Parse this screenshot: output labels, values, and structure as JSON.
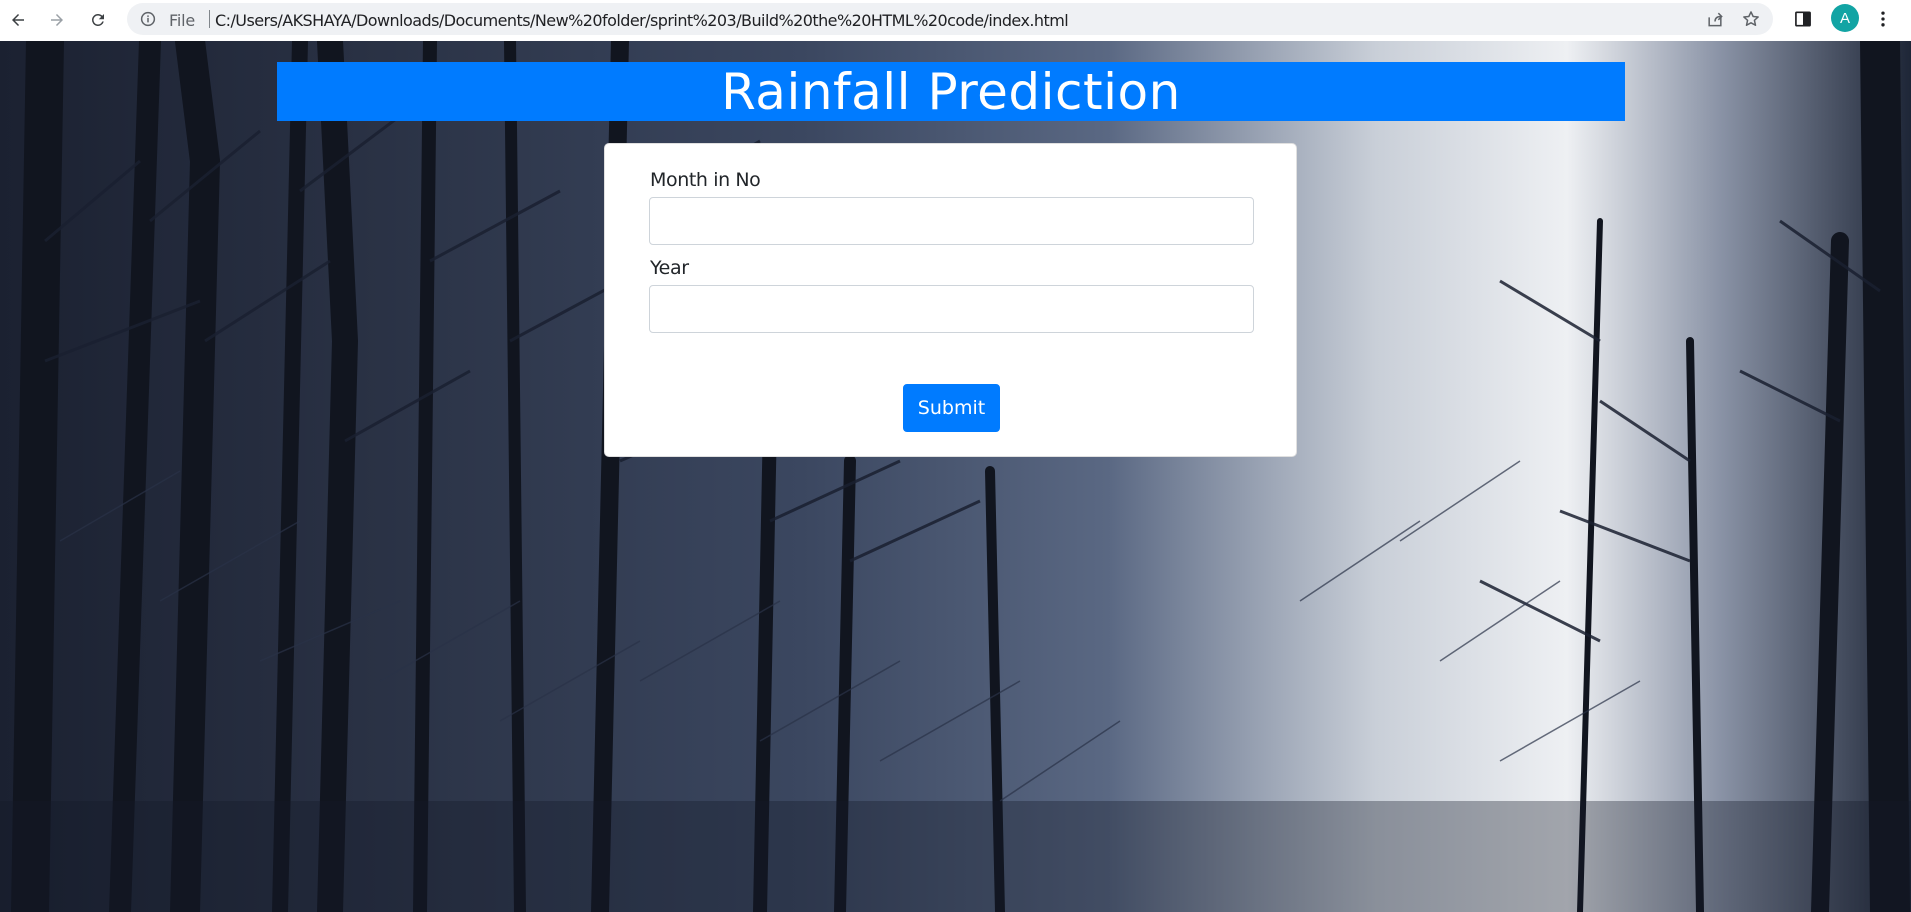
{
  "browser": {
    "scheme_label": "File",
    "url": "C:/Users/AKSHAYA/Downloads/Documents/New%20folder/sprint%203/Build%20the%20HTML%20code/index.html",
    "profile_initial": "A",
    "profile_color": "#12a4a4",
    "icons": [
      "back-arrow-icon",
      "forward-arrow-icon",
      "reload-icon",
      "info-icon",
      "share-icon",
      "bookmark-star-icon",
      "side-panel-icon",
      "more-menu-icon"
    ]
  },
  "page": {
    "title": "Rainfall Prediction",
    "accent_color": "#007bff",
    "form": {
      "month_label": "Month in No",
      "month_value": "",
      "year_label": "Year",
      "year_value": "",
      "submit_label": "Submit"
    }
  }
}
